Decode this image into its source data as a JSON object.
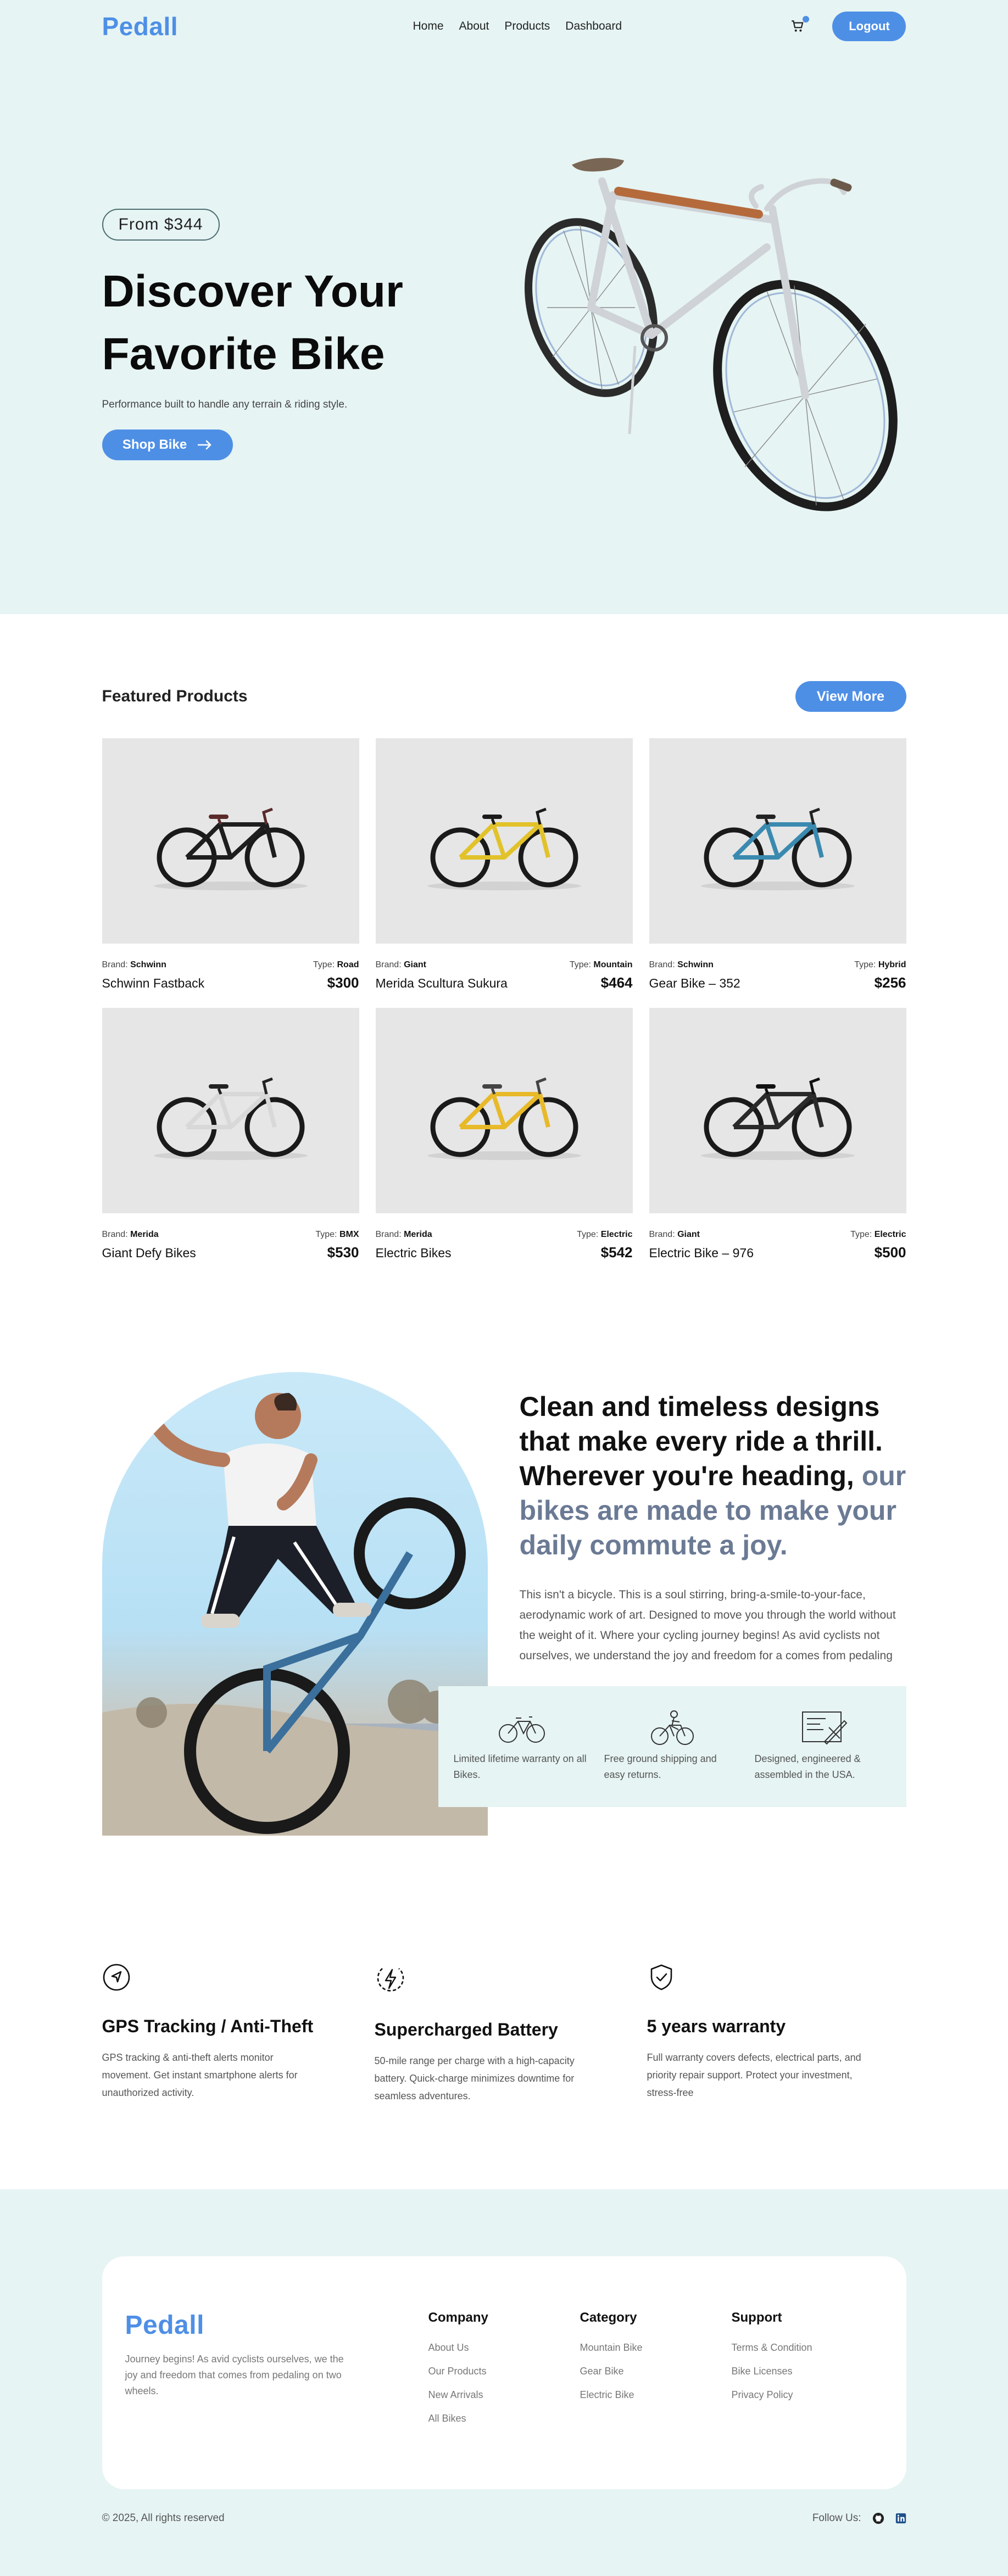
{
  "nav": {
    "logo": "Pedall",
    "links": [
      "Home",
      "About",
      "Products",
      "Dashboard"
    ],
    "logout_label": "Logout"
  },
  "hero": {
    "price_pill": "From $344",
    "title_line1": "Discover Your",
    "title_line2": "Favorite Bike",
    "subtitle": "Performance built to handle any terrain & riding style.",
    "cta_label": "Shop Bike"
  },
  "featured": {
    "title": "Featured Products",
    "view_more_label": "View More",
    "brand_prefix": "Brand:",
    "type_prefix": "Type:",
    "products": [
      {
        "brand": "Schwinn",
        "type": "Road",
        "name": "Schwinn Fastback",
        "price": "$300",
        "color": "#1e1e1e",
        "accent": "#5a2a2a"
      },
      {
        "brand": "Giant",
        "type": "Mountain",
        "name": "Merida Scultura Sukura",
        "price": "$464",
        "color": "#e2c22a",
        "accent": "#1a1a1a"
      },
      {
        "brand": "Schwinn",
        "type": "Hybrid",
        "name": "Gear Bike – 352",
        "price": "$256",
        "color": "#3a8ab0",
        "accent": "#222222"
      },
      {
        "brand": "Merida",
        "type": "BMX",
        "name": "Giant Defy Bikes",
        "price": "$530",
        "color": "#d8d8d8",
        "accent": "#222222"
      },
      {
        "brand": "Merida",
        "type": "Electric",
        "name": "Electric Bikes",
        "price": "$542",
        "color": "#e8b928",
        "accent": "#444444"
      },
      {
        "brand": "Giant",
        "type": "Electric",
        "name": "Electric Bike – 976",
        "price": "$500",
        "color": "#2a2a2a",
        "accent": "#111111"
      }
    ]
  },
  "story": {
    "headline_dark": "Clean and timeless designs that make every ride a thrill. Wherever you're heading,",
    "headline_muted": "our bikes are made to make your daily commute a joy.",
    "paragraph": "This isn't a bicycle. This is a soul stirring, bring-a-smile-to-your-face, aerodynamic work of art. Designed to move you through the world without the weight of it. Where your cycling journey begins! As avid cyclists not ourselves, we understand the joy and freedom for a comes from pedaling",
    "features": [
      {
        "icon": "bicycle-icon",
        "text": "Limited lifetime warranty on all Bikes."
      },
      {
        "icon": "delivery-bike-icon",
        "text": "Free ground shipping and easy returns."
      },
      {
        "icon": "blueprint-icon",
        "text": "Designed, engineered & assembled in the USA."
      }
    ]
  },
  "benefits": [
    {
      "icon": "navigation-icon",
      "title": "GPS Tracking / Anti-Theft",
      "text": "GPS tracking & anti-theft alerts monitor movement. Get instant smartphone alerts for unauthorized activity."
    },
    {
      "icon": "battery-bolt-icon",
      "title": "Supercharged Battery",
      "text": "50-mile range per charge with a high-capacity battery. Quick-charge minimizes downtime for seamless adventures."
    },
    {
      "icon": "shield-check-icon",
      "title": "5 years warranty",
      "text": "Full warranty covers defects, electrical parts, and priority repair support. Protect your investment, stress-free"
    }
  ],
  "footer": {
    "logo": "Pedall",
    "description": "Journey begins! As avid cyclists ourselves, we the joy and freedom that comes from pedaling on two wheels.",
    "columns": [
      {
        "title": "Company",
        "links": [
          "About Us",
          "Our Products",
          "New Arrivals",
          "All Bikes"
        ]
      },
      {
        "title": "Category",
        "links": [
          "Mountain Bike",
          "Gear Bike",
          "Electric Bike"
        ]
      },
      {
        "title": "Support",
        "links": [
          "Terms & Condition",
          "Bike Licenses",
          "Privacy Policy"
        ]
      }
    ],
    "copyright": "© 2025, All rights reserved",
    "follow_label": "Follow Us:"
  },
  "colors": {
    "brand": "#4e8fe6",
    "mint_bg": "#e6f4f3",
    "muted_text": "#6b7a94"
  }
}
